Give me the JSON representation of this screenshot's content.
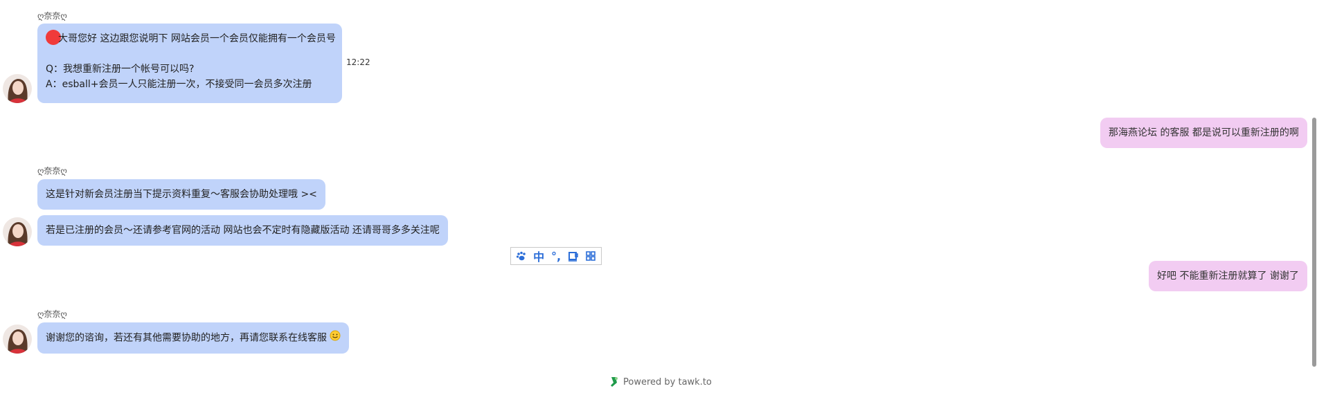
{
  "agent": {
    "name": "ღ奈奈ღ"
  },
  "messages": {
    "m1": {
      "lines": [
        "大哥您好 这边跟您说明下 网站会员一个会员仅能拥有一个会员号",
        "Q：我想重新注册一个帐号可以吗?",
        "A：esball+会员一人只能注册一次，不接受同一会员多次注册"
      ],
      "time": "12:22"
    },
    "m2": {
      "text": "那海燕论坛 的客服 都是说可以重新注册的啊"
    },
    "m3": {
      "text": "这是针对新会员注册当下提示资料重复～客服会协助处理哦 ><"
    },
    "m4": {
      "text": "若是已注册的会员～还请参考官网的活动 网站也会不定时有隐藏版活动 还请哥哥多多关注呢"
    },
    "m5": {
      "text": "好吧 不能重新注册就算了 谢谢了"
    },
    "m6": {
      "text": "谢谢您的谘询，若还有其他需要协助的地方，再请您联系在线客服"
    }
  },
  "ime_toolbar": {
    "items": [
      "paw-icon",
      "中",
      "°,",
      "cup-icon",
      "grid-icon"
    ],
    "mode_label": "中",
    "punct_label": "°,"
  },
  "footer": {
    "powered_by": "Powered by tawk.to"
  },
  "colors": {
    "agent_bubble": "#c0d3fa",
    "visitor_bubble": "#f2ccf2",
    "ime_accent": "#2c6ed8"
  }
}
